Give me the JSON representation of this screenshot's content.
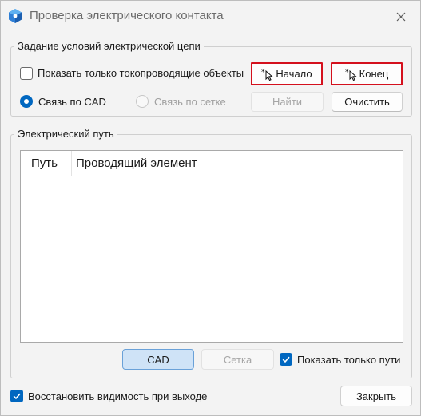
{
  "window": {
    "title": "Проверка электрического контакта"
  },
  "conditions_group": {
    "title": "Задание условий электрической цепи",
    "show_conductive_label": "Показать только токопроводящие объекты",
    "show_conductive_checked": false,
    "radio_cad_label": "Связь по CAD",
    "radio_cad_checked": true,
    "radio_mesh_label": "Связь по сетке",
    "radio_mesh_checked": false,
    "start_button": "Начало",
    "end_button": "Конец",
    "find_button": "Найти",
    "clear_button": "Очистить"
  },
  "path_group": {
    "title": "Электрический путь",
    "columns": [
      "Путь",
      "Проводящий элемент"
    ],
    "rows": [],
    "cad_button": "CAD",
    "mesh_button": "Сетка",
    "show_path_only_label": "Показать только пути",
    "show_path_only_checked": true
  },
  "footer": {
    "restore_visibility_label": "Восстановить видимость при выходе",
    "restore_visibility_checked": true,
    "close_button": "Закрыть"
  },
  "colors": {
    "accent": "#0067c0",
    "highlight_border": "#d4101d",
    "pressed_button": "#cfe3f7"
  },
  "icons": {
    "app": "app-logo-icon",
    "close": "close-icon",
    "pick_cursor": "pick-cursor-icon",
    "checkmark": "checkmark-icon"
  }
}
